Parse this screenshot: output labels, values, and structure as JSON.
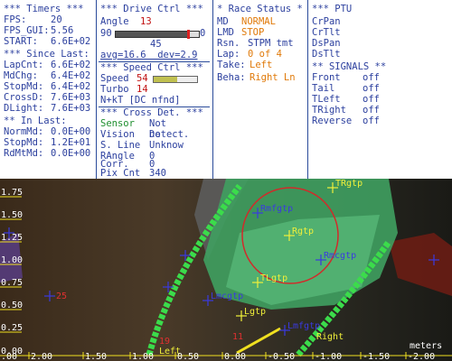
{
  "timers": {
    "header": "*** Timers ***",
    "rows": [
      {
        "label": "FPS:",
        "value": "20"
      },
      {
        "label": "FPS_GUI:",
        "value": "5.56"
      },
      {
        "label": "START:",
        "value": "6.6E+02"
      }
    ],
    "since_header": "*** Since Last:",
    "since": [
      {
        "label": "LapCnt:",
        "value": "6.6E+02"
      },
      {
        "label": "MdChg:",
        "value": "6.4E+02"
      },
      {
        "label": "StopMd:",
        "value": "6.4E+02"
      },
      {
        "label": "CrossD:",
        "value": "7.6E+03"
      },
      {
        "label": "DLight:",
        "value": "7.6E+03"
      }
    ],
    "in_header": "** In Last:",
    "in_last": [
      {
        "label": "NormMd:",
        "value": "0.0E+00"
      },
      {
        "label": "StopMd:",
        "value": "1.2E+01"
      },
      {
        "label": "RdMtMd:",
        "value": "0.0E+00"
      }
    ]
  },
  "drive": {
    "header": "*** Drive Ctrl ***",
    "angle_label": "Angle",
    "angle_value": "13",
    "slider_min": "90",
    "slider_max": "0",
    "slider_value": "45",
    "slider_position_fraction": 0.87,
    "avg_text": "avg=16.6  dev=2.9",
    "speed_header": "*** Speed Ctrl ***",
    "speed_label": "Speed",
    "speed_value": "54",
    "speed_bar_fraction": 0.55,
    "turbo_label": "Turbo",
    "turbo_value": "14",
    "nkt_text": "N+kT [DC nfnd]",
    "cross_header": "*** Cross Det. ***",
    "cross_rows": [
      {
        "label": "Sensor",
        "value": "Not Detect."
      },
      {
        "label": "Vision",
        "value": "no"
      },
      {
        "label": "S. Line",
        "value": "Unknow"
      },
      {
        "label": "RAngle",
        "value": "0"
      },
      {
        "label": "Corr.",
        "value": "0"
      },
      {
        "label": "Pix Cnt",
        "value": "340"
      }
    ]
  },
  "race": {
    "header": "* Race Status *",
    "rows": [
      {
        "label": "MD",
        "value": "NORMAL"
      },
      {
        "label": "LMD",
        "value": "STOP"
      },
      {
        "label": "Rsn.",
        "value": "STPM tmt"
      },
      {
        "label": "Lap:",
        "value": "0 of 4"
      },
      {
        "label": "Take:",
        "value": "Left"
      },
      {
        "label": "Beha:",
        "value": "Right Ln"
      }
    ]
  },
  "ptu": {
    "header": "*** PTU",
    "items": [
      "CrPan",
      "CrTlt",
      "DsPan",
      "DsTlt"
    ],
    "signals_header": "** SIGNALS **",
    "signals": [
      {
        "label": "Front",
        "value": "off"
      },
      {
        "label": "Tail",
        "value": "off"
      },
      {
        "label": "TLeft",
        "value": "off"
      },
      {
        "label": "TRight",
        "value": "off"
      },
      {
        "label": "Reverse",
        "value": "off"
      }
    ]
  },
  "viz": {
    "y_ticks": [
      "1.75",
      "1.50",
      "1.25",
      "1.00",
      "0.75",
      "0.50",
      "0.25",
      "0.00"
    ],
    "x_ticks": [
      "2.00",
      "1.50",
      "1.00",
      "0.50",
      "0.00",
      "-0.50",
      "-1.00",
      "-1.50",
      "-2.00"
    ],
    "x_prefix_left": ".00",
    "units": "meters",
    "markers": [
      {
        "name": "TRgtp",
        "color": "#f0f03a"
      },
      {
        "name": "Rmfgtp",
        "color": "#3a3ae0"
      },
      {
        "name": "Rgtp",
        "color": "#f0f03a"
      },
      {
        "name": "Rmcgtp",
        "color": "#3a3ae0"
      },
      {
        "name": "TLgtp",
        "color": "#f0f03a"
      },
      {
        "name": "Lmcgtp",
        "color": "#3a3ae0"
      },
      {
        "name": "Lgtp",
        "color": "#f0f03a"
      },
      {
        "name": "Lmfgtp",
        "color": "#3a3ae0"
      }
    ],
    "labels_red": [
      "25",
      "19",
      "11",
      "Left",
      "Right"
    ]
  }
}
